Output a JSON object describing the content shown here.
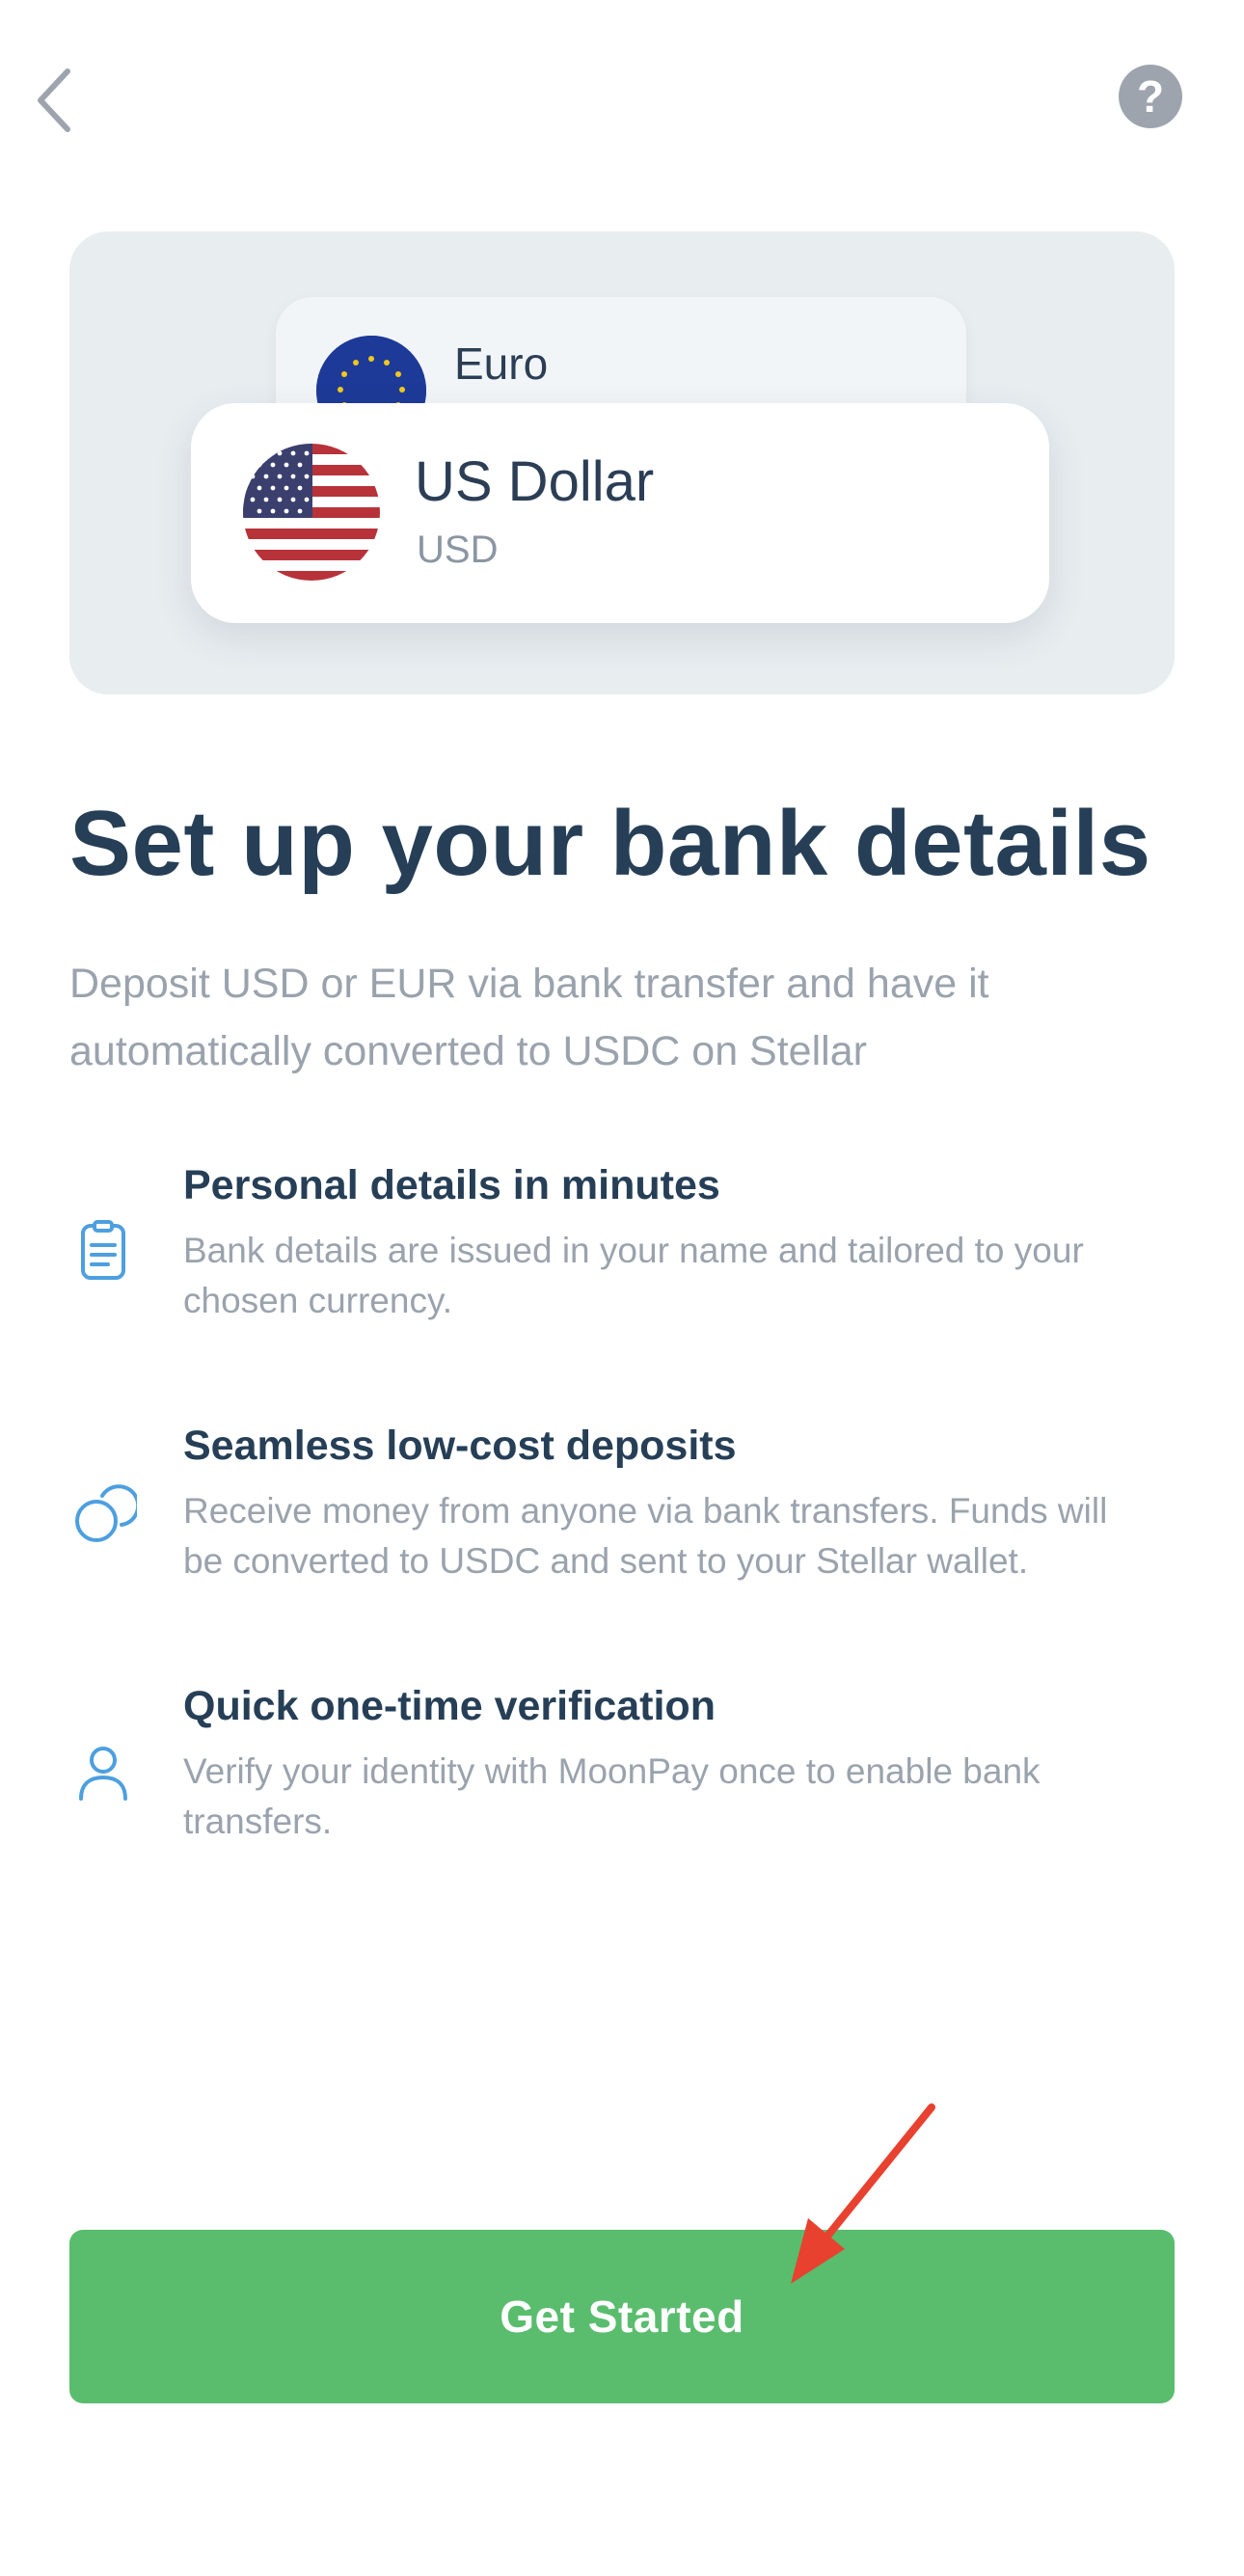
{
  "header": {
    "back_icon": "chevron-left-icon",
    "help_icon": "question-mark-icon",
    "help_glyph": "?"
  },
  "currency_cards": [
    {
      "name": "Euro",
      "flag": "eu-flag-icon"
    },
    {
      "name": "US Dollar",
      "code": "USD",
      "flag": "us-flag-icon"
    }
  ],
  "title": "Set up your bank details",
  "subtitle": "Deposit USD or EUR via bank transfer and have it automatically converted to USDC on Stellar",
  "features": [
    {
      "icon": "document-icon",
      "title": "Personal details in minutes",
      "description": "Bank details are issued in your name and tailored to your chosen currency."
    },
    {
      "icon": "coins-icon",
      "title": "Seamless low-cost deposits",
      "description": "Receive money from anyone via bank transfers. Funds will be converted to USDC and sent to your Stellar wallet."
    },
    {
      "icon": "person-icon",
      "title": "Quick one-time verification",
      "description": "Verify your identity with MoonPay once to enable bank transfers."
    }
  ],
  "cta": {
    "label": "Get Started"
  },
  "colors": {
    "primary_text": "#263f57",
    "secondary_text": "#9aa3ad",
    "accent_icon": "#4d9fe0",
    "button": "#59bd6d",
    "hero_bg": "#e8edf0",
    "annotation_arrow": "#e8412f"
  }
}
